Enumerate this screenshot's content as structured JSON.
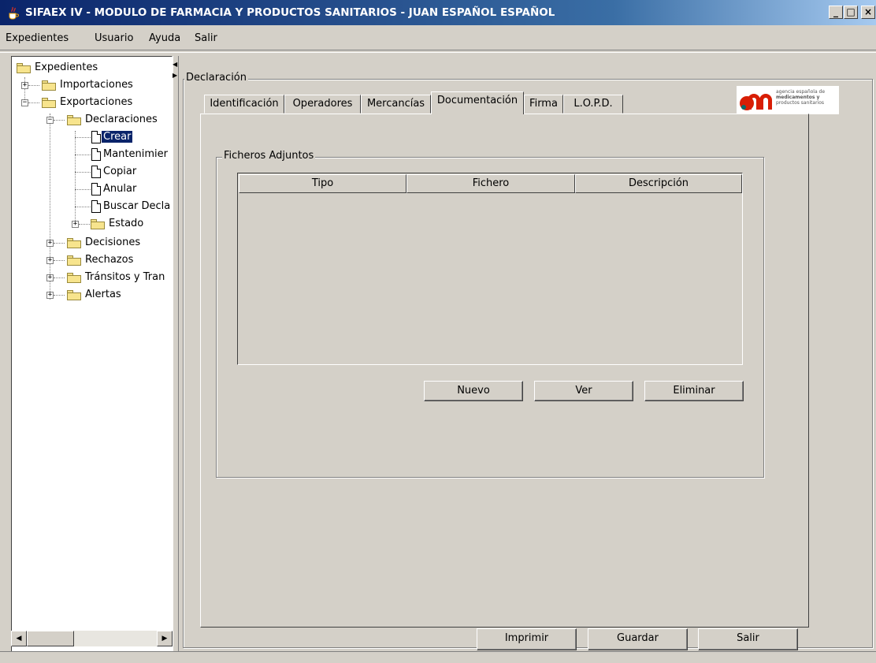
{
  "window": {
    "title": "SIFAEX IV - MODULO DE FARMACIA Y PRODUCTOS SANITARIOS - JUAN ESPAÑOL ESPAÑOL",
    "controls": [
      "_",
      "□",
      "×"
    ]
  },
  "menu": {
    "items": [
      "Expedientes",
      "Usuario",
      "Ayuda",
      "Salir"
    ]
  },
  "tree": {
    "root": "Expedientes",
    "importaciones": "Importaciones",
    "exportaciones": "Exportaciones",
    "declaraciones": "Declaraciones",
    "crear": "Crear",
    "mantenimiento": "Mantenimier",
    "copiar": "Copiar",
    "anular": "Anular",
    "buscar": "Buscar Decla",
    "estado": "Estado",
    "decisiones": "Decisiones",
    "rechazos": "Rechazos",
    "transitos": "Tránsitos y Tran",
    "alertas": "Alertas"
  },
  "main": {
    "group_title": "Declaración",
    "tabs": [
      "Identificación",
      "Operadores",
      "Mercancías",
      "Documentación",
      "Firma",
      "L.O.P.D."
    ],
    "active_tab": "Documentación",
    "attachments_title": "Ficheros Adjuntos",
    "columns": [
      "Tipo",
      "Fichero",
      "Descripción"
    ],
    "rows": [],
    "buttons": {
      "nuevo": "Nuevo",
      "ver": "Ver",
      "eliminar": "Eliminar"
    },
    "logo_text": [
      "agencia española de",
      "medicamentos y",
      "productos sanitarios"
    ]
  },
  "footer": {
    "imprimir": "Imprimir",
    "guardar": "Guardar",
    "salir": "Salir"
  },
  "colors": {
    "titlebar": "#0a246a",
    "selection": "#0a246a",
    "logo_red": "#d81e05",
    "window_bg": "#d4d0c8"
  }
}
